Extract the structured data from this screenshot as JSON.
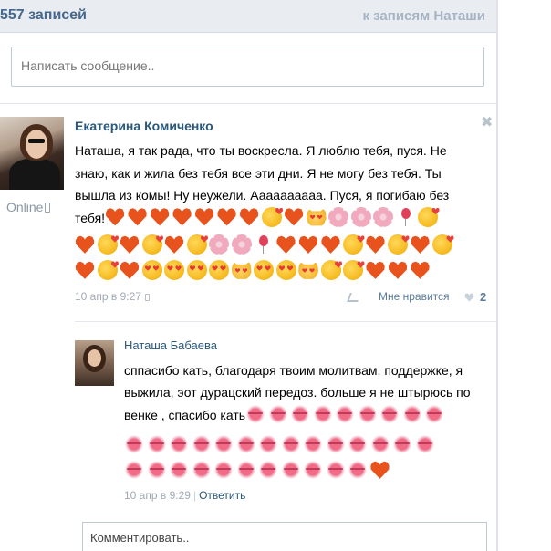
{
  "header": {
    "count_label": "557 записей",
    "to_posts_link": "к записям Наташи"
  },
  "post_form": {
    "placeholder": "Написать сообщение.."
  },
  "post": {
    "author": "Екатерина Комиченко",
    "status": "Online",
    "text": "Наташа, я так рада, что ты воскресла. Я люблю тебя, пуся. Не знаю, как и жила без тебя все эти дни. Я не могу без тебя. Ты вышла из комы! Ну неужели. Аааааааааа. Пуся, я погибаю без тебя!",
    "emoji_line1": [
      "heart",
      "heart",
      "heart",
      "heart",
      "heart",
      "heart",
      "heart",
      "kiss",
      "heart",
      "cat",
      "flower",
      "flower",
      "flower",
      "balloon",
      "kiss"
    ],
    "emoji_rows": [
      [
        "heart",
        "kiss",
        "heart",
        "kiss",
        "heart",
        "kiss",
        "flower",
        "flower",
        "balloon",
        "heart",
        "heart",
        "heart",
        "kiss",
        "heart",
        "kiss",
        "heart",
        "kiss"
      ],
      [
        "heart",
        "kiss",
        "heart",
        "eyes",
        "eyes",
        "eyes",
        "eyes",
        "cat",
        "eyes",
        "eyes",
        "cat",
        "kiss",
        "kiss",
        "heart",
        "heart",
        "heart"
      ]
    ],
    "date": "10 апр в 9:27",
    "like_label": "Мне нравится",
    "like_count": "2"
  },
  "reply": {
    "author": "Наташа Бабаева",
    "text": "сппасибо кать, благодаря твоим молитвам, поддержке, я выжила, эот дурацский передоз. больше я не штырюсь по венке , спасибо кать",
    "emoji_line1": [
      "lips",
      "lips",
      "lips",
      "lips",
      "lips",
      "lips",
      "lips",
      "lips",
      "lips"
    ],
    "emoji_rows": [
      [
        "lips",
        "lips",
        "lips",
        "lips",
        "lips",
        "lips",
        "lips",
        "lips",
        "lips",
        "lips",
        "lips",
        "lips",
        "lips",
        "lips"
      ],
      [
        "lips",
        "lips",
        "lips",
        "lips",
        "lips",
        "lips",
        "lips",
        "lips",
        "lips",
        "lips",
        "lips",
        "heart"
      ]
    ],
    "date": "10 апр в 9:29",
    "reply_label": "Ответить"
  },
  "comment_form": {
    "placeholder": "Комментировать.."
  }
}
